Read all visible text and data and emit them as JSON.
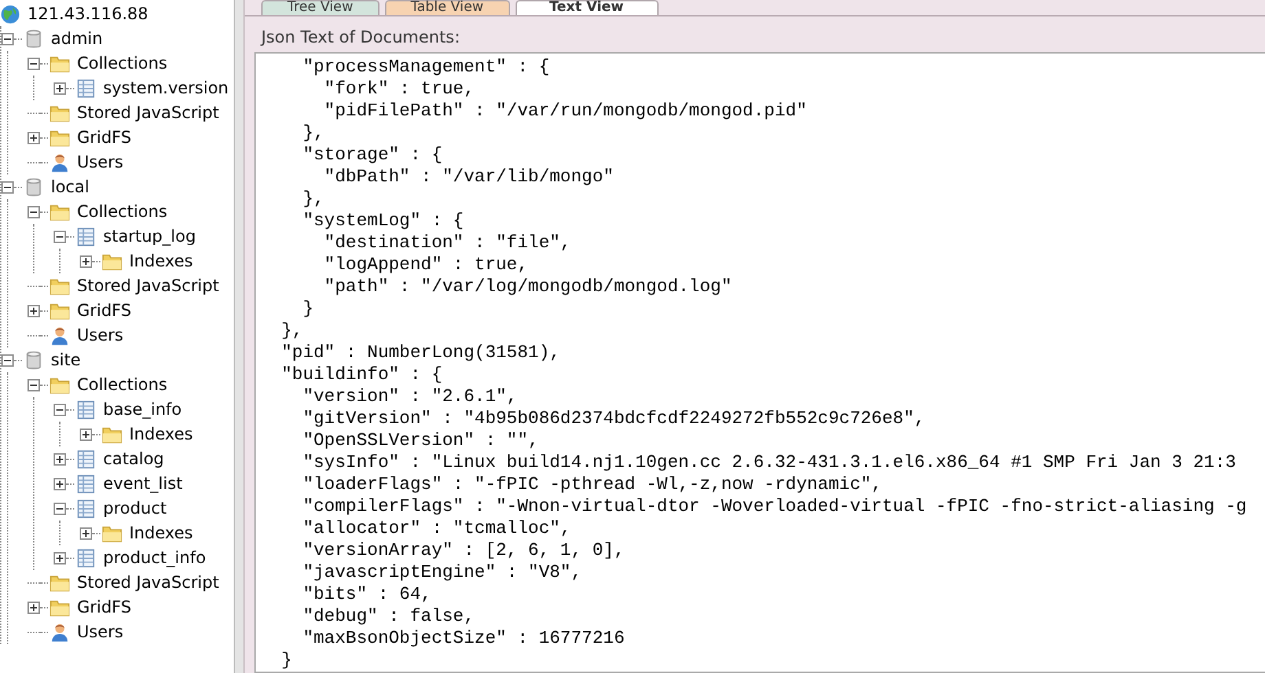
{
  "tree": {
    "label": "121.43.116.88",
    "kind": "server",
    "children": [
      {
        "label": "admin",
        "kind": "database",
        "expanded": true,
        "children": [
          {
            "label": "Collections",
            "kind": "folder",
            "expanded": true,
            "children": [
              {
                "label": "system.version",
                "kind": "collection",
                "expanded": false
              }
            ]
          },
          {
            "label": "Stored JavaScript",
            "kind": "folder"
          },
          {
            "label": "GridFS",
            "kind": "folder",
            "expanded": false
          },
          {
            "label": "Users",
            "kind": "users"
          }
        ]
      },
      {
        "label": "local",
        "kind": "database",
        "expanded": true,
        "children": [
          {
            "label": "Collections",
            "kind": "folder",
            "expanded": true,
            "children": [
              {
                "label": "startup_log",
                "kind": "collection",
                "expanded": true,
                "children": [
                  {
                    "label": "Indexes",
                    "kind": "folder",
                    "expanded": false
                  }
                ]
              }
            ]
          },
          {
            "label": "Stored JavaScript",
            "kind": "folder"
          },
          {
            "label": "GridFS",
            "kind": "folder",
            "expanded": false
          },
          {
            "label": "Users",
            "kind": "users"
          }
        ]
      },
      {
        "label": "site",
        "kind": "database",
        "expanded": true,
        "children": [
          {
            "label": "Collections",
            "kind": "folder",
            "expanded": true,
            "children": [
              {
                "label": "base_info",
                "kind": "collection",
                "expanded": true,
                "children": [
                  {
                    "label": "Indexes",
                    "kind": "folder",
                    "expanded": false
                  }
                ]
              },
              {
                "label": "catalog",
                "kind": "collection",
                "expanded": false
              },
              {
                "label": "event_list",
                "kind": "collection",
                "expanded": false
              },
              {
                "label": "product",
                "kind": "collection",
                "expanded": true,
                "children": [
                  {
                    "label": "Indexes",
                    "kind": "folder",
                    "expanded": false
                  }
                ]
              },
              {
                "label": "product_info",
                "kind": "collection",
                "expanded": false
              }
            ]
          },
          {
            "label": "Stored JavaScript",
            "kind": "folder"
          },
          {
            "label": "GridFS",
            "kind": "folder",
            "expanded": false
          },
          {
            "label": "Users",
            "kind": "users"
          }
        ]
      }
    ]
  },
  "tabs": [
    {
      "label": "Tree View",
      "selected": false,
      "color": "#d3e4dc"
    },
    {
      "label": "Table View",
      "selected": false,
      "color": "#f7d3b1"
    },
    {
      "label": "Text View",
      "selected": true,
      "color": "#ffffff"
    }
  ],
  "text_label": "Json Text of Documents:",
  "json_lines": [
    "    \"processManagement\" : {",
    "      \"fork\" : true,",
    "      \"pidFilePath\" : \"/var/run/mongodb/mongod.pid\"",
    "    },",
    "    \"storage\" : {",
    "      \"dbPath\" : \"/var/lib/mongo\"",
    "    },",
    "    \"systemLog\" : {",
    "      \"destination\" : \"file\",",
    "      \"logAppend\" : true,",
    "      \"path\" : \"/var/log/mongodb/mongod.log\"",
    "    }",
    "  },",
    "  \"pid\" : NumberLong(31581),",
    "  \"buildinfo\" : {",
    "    \"version\" : \"2.6.1\",",
    "    \"gitVersion\" : \"4b95b086d2374bdcfcdf2249272fb552c9c726e8\",",
    "    \"OpenSSLVersion\" : \"\",",
    "    \"sysInfo\" : \"Linux build14.nj1.10gen.cc 2.6.32-431.3.1.el6.x86_64 #1 SMP Fri Jan 3 21:3",
    "    \"loaderFlags\" : \"-fPIC -pthread -Wl,-z,now -rdynamic\",",
    "    \"compilerFlags\" : \"-Wnon-virtual-dtor -Woverloaded-virtual -fPIC -fno-strict-aliasing -g",
    "    \"allocator\" : \"tcmalloc\",",
    "    \"versionArray\" : [2, 6, 1, 0],",
    "    \"javascriptEngine\" : \"V8\",",
    "    \"bits\" : 64,",
    "    \"debug\" : false,",
    "    \"maxBsonObjectSize\" : 16777216",
    "  }"
  ]
}
